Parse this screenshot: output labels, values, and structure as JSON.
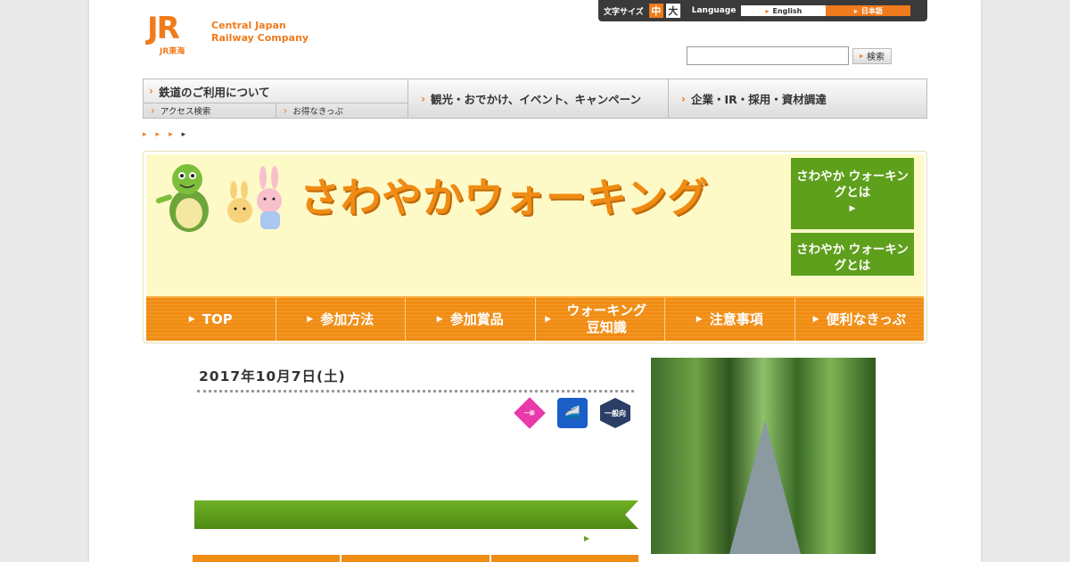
{
  "header": {
    "logo_mark": "JR",
    "logo_sub": "JR東海",
    "logo_line1": "Central Japan",
    "logo_line2": "Railway Company"
  },
  "util_bar": {
    "font_size_label": "文字サイズ",
    "size_medium": "中",
    "size_large": "大",
    "language_label": "Language",
    "lang_english": "English",
    "lang_japanese": "日本語"
  },
  "search": {
    "label": "",
    "placeholder": "",
    "button": "検索"
  },
  "global_nav": {
    "rail": "鉄道のご利用について",
    "access": "アクセス検索",
    "tickets": "お得なきっぷ",
    "tourism": "観光・おでかけ、イベント、キャンペーン",
    "corporate": "企業・IR・採用・資材調達"
  },
  "breadcrumbs": [
    {
      "label": ""
    },
    {
      "label": ""
    },
    {
      "label": ""
    },
    {
      "label": ""
    }
  ],
  "hero": {
    "title": "さわやかウォーキング",
    "side_button_1": "さわやか ウォーキングとは",
    "side_button_2": "さわやか ウォーキングとは"
  },
  "tabs": [
    {
      "label": "TOP"
    },
    {
      "label": "参加方法"
    },
    {
      "label": "参加賞品"
    },
    {
      "label": "ウォーキング 豆知識"
    },
    {
      "label": "注意事項"
    },
    {
      "label": "便利なきっぷ"
    }
  ],
  "event": {
    "date": "2017年10月7日(土)",
    "badge_1": "一部",
    "badge_3": "一般向",
    "headline_line1": "",
    "headline_line2": "",
    "banner": "",
    "more_link": "",
    "photo_caption": ""
  },
  "colors": {
    "accent_orange": "#f07b1c",
    "accent_green": "#5e9f1c",
    "hero_bg": "#fefac8"
  }
}
